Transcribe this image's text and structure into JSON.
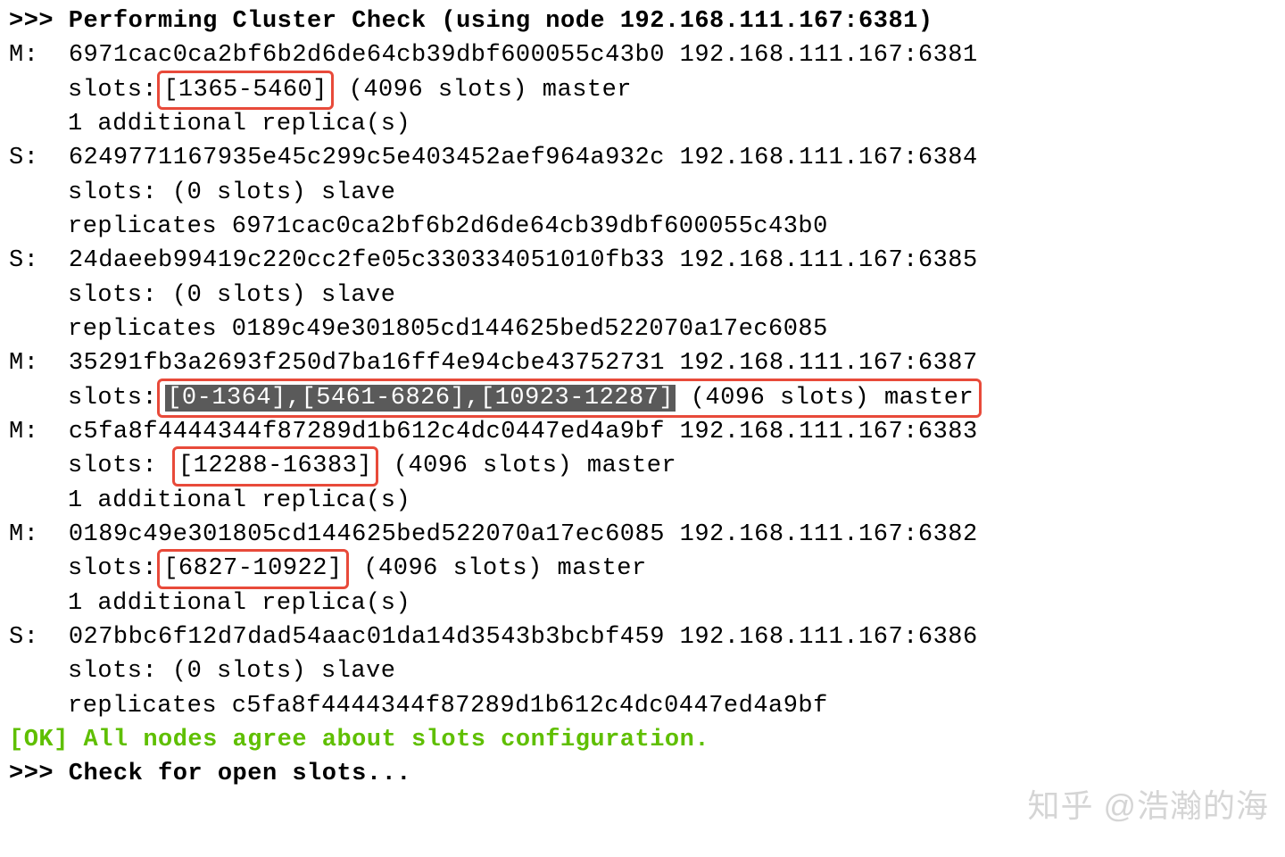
{
  "header": ">>> Performing Cluster Check (using node 192.168.111.167:6381)",
  "nodes": [
    {
      "marker": "M:",
      "hash": "6971cac0ca2bf6b2d6de64cb39dbf600055c43b0",
      "addr": "192.168.111.167:6381",
      "slots_prefix": "slots:",
      "slot_box": "[1365-5460]",
      "slots_suffix": " (4096 slots) master",
      "replicas_line": "1 additional replica(s)"
    },
    {
      "marker": "S:",
      "hash": "6249771167935e45c299c5e403452aef964a932c",
      "addr": "192.168.111.167:6384",
      "slots_line": "slots: (0 slots) slave",
      "replicates": "replicates 6971cac0ca2bf6b2d6de64cb39dbf600055c43b0"
    },
    {
      "marker": "S:",
      "hash": "24daeeb99419c220cc2fe05c330334051010fb33",
      "addr": "192.168.111.167:6385",
      "slots_line": "slots: (0 slots) slave",
      "replicates": "replicates 0189c49e301805cd144625bed522070a17ec6085"
    },
    {
      "marker": "M:",
      "hash": "35291fb3a2693f250d7ba16ff4e94cbe43752731",
      "addr": "192.168.111.167:6387",
      "slots_prefix": "slots:",
      "slot_hl": "[0-1364],[5461-6826],[10923-12287]",
      "slots_suffix": " (4096 slots) master"
    },
    {
      "marker": "M:",
      "hash": "c5fa8f4444344f87289d1b612c4dc0447ed4a9bf",
      "addr": "192.168.111.167:6383",
      "slots_prefix": "slots:",
      "slot_box": "[12288-16383]",
      "slots_suffix": " (4096 slots) master",
      "replicas_line": "1 additional replica(s)"
    },
    {
      "marker": "M:",
      "hash": "0189c49e301805cd144625bed522070a17ec6085",
      "addr": "192.168.111.167:6382",
      "slots_prefix": "slots:",
      "slot_box": "[6827-10922]",
      "slots_suffix": " (4096 slots) master",
      "replicas_line": "1 additional replica(s)"
    },
    {
      "marker": "S:",
      "hash": "027bbc6f12d7dad54aac01da14d3543b3bcbf459",
      "addr": "192.168.111.167:6386",
      "slots_line": "slots: (0 slots) slave",
      "replicates": "replicates c5fa8f4444344f87289d1b612c4dc0447ed4a9bf"
    }
  ],
  "ok_line": "[OK] All nodes agree about slots configuration.",
  "check_open": ">>> Check for open slots...",
  "watermark": "知乎 @浩瀚的海"
}
